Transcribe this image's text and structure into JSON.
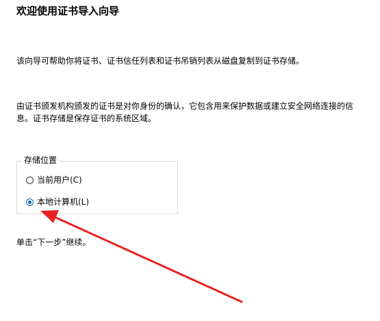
{
  "wizard": {
    "title": "欢迎使用证书导入向导",
    "intro": "该向导可帮助你将证书、证书信任列表和证书吊销列表从磁盘复制到证书存储。",
    "description": "由证书颁发机构颁发的证书是对你身份的确认，它包含用来保护数据或建立安全网络连接的信息。证书存储是保存证书的系统区域。",
    "store_location": {
      "label": "存储位置",
      "options": [
        {
          "label": "当前用户(C)",
          "selected": false
        },
        {
          "label": "本地计算机(L)",
          "selected": true
        }
      ]
    },
    "footer": "单击“下一步”继续。"
  },
  "annotation": {
    "arrow_color": "#e8231f"
  }
}
